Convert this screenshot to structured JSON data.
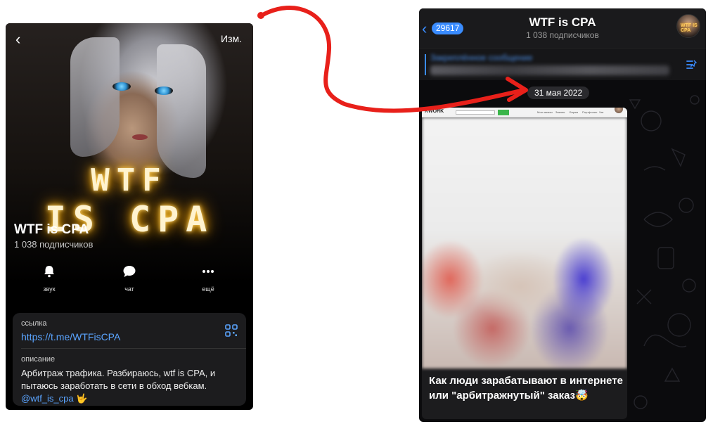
{
  "profile": {
    "back_icon": "chevron-left-icon",
    "edit_label": "Изм.",
    "cover_line1": "WTF",
    "cover_line2": "IS CPA",
    "name": "WTF is CPA",
    "subscribers": "1 038 подписчиков",
    "actions": [
      {
        "icon": "bell-icon",
        "label": "звук"
      },
      {
        "icon": "chat-bubble-icon",
        "label": "чат"
      },
      {
        "icon": "more-dots-icon",
        "label": "ещё"
      }
    ],
    "link_label": "ссылка",
    "link_value": "https://t.me/WTFisCPA",
    "qr_icon": "qr-code-icon",
    "description_label": "описание",
    "description_text": "Арбитраж трафика. Разбираюсь, wtf is CPA, и пытаюсь заработать в сети в обход вебкам.",
    "handle": "@wtf_is_cpa",
    "handle_emoji": "🤟"
  },
  "arrow": {
    "color": "#e8201a"
  },
  "chat": {
    "back_icon": "chevron-left-icon",
    "unread_count": "29617",
    "title": "WTF is CPA",
    "subscribers": "1 038 подписчиков",
    "avatar_text": "WTF IS CPA",
    "pinned_title": "Закреплённое сообщение",
    "pin_icon": "pinned-list-icon",
    "date": "31 мая 2022",
    "thumb": {
      "logo": "KWORK",
      "nav": [
        "Мои заказы",
        "Заказы",
        "Биржа",
        "Портфолио",
        "Чат"
      ]
    },
    "message_text": "Как люди зарабатывают в интернете или \"арбитражнутый\" заказ🤯"
  },
  "colors": {
    "accent_blue": "#3a8cff",
    "link_blue": "#5aa4ff",
    "glow": "#ffb400",
    "dark_bg": "#000000",
    "card_bg": "#1c1c1e"
  }
}
